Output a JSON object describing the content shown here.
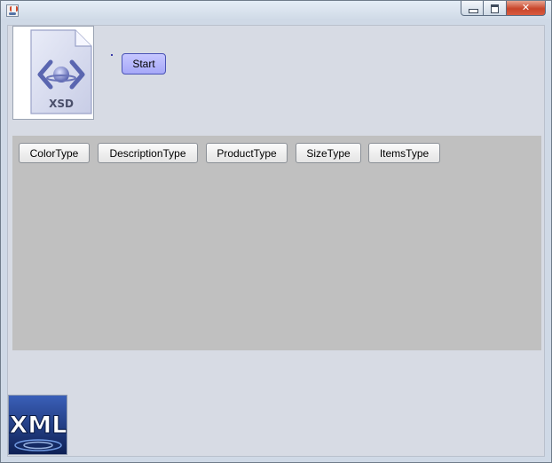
{
  "window": {
    "title": "",
    "controls": [
      "minimize-icon",
      "maximize-icon",
      "close-icon"
    ]
  },
  "header": {
    "xsd_icon_text": "XSD",
    "start_label": "Start"
  },
  "types": [
    {
      "label": "ColorType"
    },
    {
      "label": "DescriptionType"
    },
    {
      "label": "ProductType"
    },
    {
      "label": "SizeType"
    },
    {
      "label": "ItemsType"
    }
  ],
  "footer": {
    "xml_logo_text": "XML"
  },
  "colors": {
    "client_bg": "#d7dbe4",
    "panel_bg": "#c0c0c0",
    "start_btn": "#a6a8f8",
    "close_btn": "#c8452a"
  }
}
